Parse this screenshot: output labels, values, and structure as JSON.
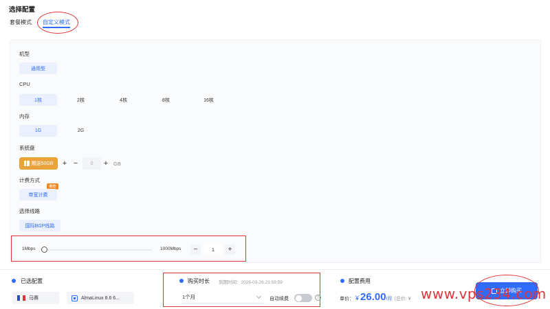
{
  "header": {
    "title": "选择配置",
    "tabs": [
      "套餐模式",
      "自定义模式"
    ]
  },
  "form": {
    "type_label": "机型",
    "type_option": "通用型",
    "cpu_label": "CPU",
    "cpu_options": [
      "1核",
      "2核",
      "4核",
      "8核",
      "16核"
    ],
    "mem_label": "内存",
    "mem_options": [
      "1G",
      "2G"
    ],
    "disk_label": "系统盘",
    "disk_gift": "赠送50GB",
    "disk_plus": "+",
    "disk_minus": "−",
    "disk_inc": "+",
    "disk_value": "0",
    "disk_unit": "GB",
    "billing_label": "计费方式",
    "billing_badge": "推荐",
    "billing_option": "带宽计费",
    "line_label": "选择线路",
    "line_option": "国际BGP线路",
    "bw_min": "1Mbps",
    "bw_max": "1000Mbps",
    "bw_minus": "−",
    "bw_value": "1",
    "bw_plus": "+"
  },
  "footer": {
    "selected_title": "已选配置",
    "region": "马赛",
    "os": "AlmaLinux 8.6 6...",
    "duration_title": "购买时长",
    "expiry": "到期时间：2026-03-26 23:59:59",
    "duration_value": "1个月",
    "auto_renew": "自动续费",
    "help": "?",
    "cost_title": "配置费用",
    "unit_label": "单价：",
    "currency": "¥",
    "price": "26.00",
    "price_unit": "/月",
    "total_prefix": "(总价: ¥",
    "buy_button": "立即购买"
  },
  "watermark": "www.vps234.com",
  "colors": {
    "accent": "#2f6bff",
    "highlight": "#e0343a",
    "gift": "#e8a33c",
    "badge": "#f08a24"
  }
}
